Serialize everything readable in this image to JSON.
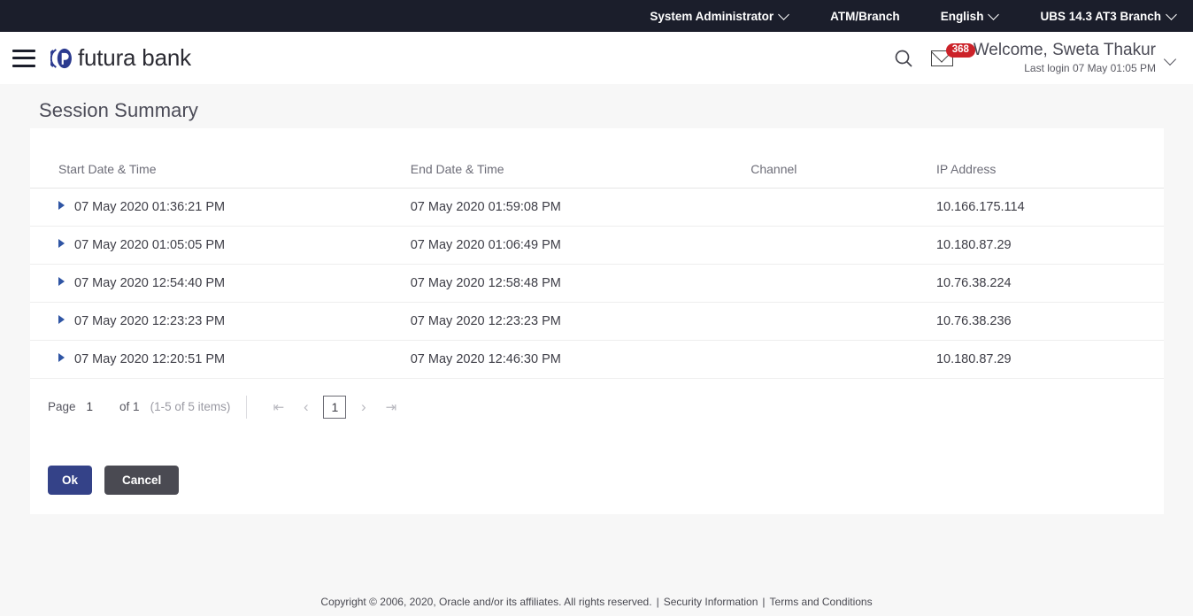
{
  "topbar": {
    "items": [
      {
        "label": "System Administrator",
        "has_chevron": true,
        "icon": "chevron-down-icon"
      },
      {
        "label": "ATM/Branch",
        "has_chevron": false,
        "icon": ""
      },
      {
        "label": "English",
        "has_chevron": true,
        "icon": "chevron-down-icon"
      },
      {
        "label": "UBS 14.3 AT3 Branch",
        "has_chevron": true,
        "icon": "chevron-down-icon"
      }
    ]
  },
  "header": {
    "menu_icon": "hamburger-menu-icon",
    "brand_name": "futura bank",
    "brand_logo_icon": "futura-bank-logo-icon",
    "search_icon": "search-icon",
    "mail_icon": "mail-envelope-icon",
    "mail_badge_count": "368",
    "welcome_text": "Welcome, Sweta Thakur",
    "last_login": "Last login 07 May 01:05 PM",
    "profile_chevron_icon": "chevron-down-icon"
  },
  "main": {
    "page_title": "Session Summary",
    "table": {
      "columns": [
        "Start Date & Time",
        "End Date & Time",
        "Channel",
        "IP Address"
      ],
      "rows": [
        {
          "expander_icon": "expand-triangle-icon",
          "start": "07 May 2020 01:36:21 PM",
          "end": "07 May 2020 01:59:08 PM",
          "channel": "",
          "ip": "10.166.175.114"
        },
        {
          "expander_icon": "expand-triangle-icon",
          "start": "07 May 2020 01:05:05 PM",
          "end": "07 May 2020 01:06:49 PM",
          "channel": "",
          "ip": "10.180.87.29"
        },
        {
          "expander_icon": "expand-triangle-icon",
          "start": "07 May 2020 12:54:40 PM",
          "end": "07 May 2020 12:58:48 PM",
          "channel": "",
          "ip": "10.76.38.224"
        },
        {
          "expander_icon": "expand-triangle-icon",
          "start": "07 May 2020 12:23:23 PM",
          "end": "07 May 2020 12:23:23 PM",
          "channel": "",
          "ip": "10.76.38.236"
        },
        {
          "expander_icon": "expand-triangle-icon",
          "start": "07 May 2020 12:20:51 PM",
          "end": "07 May 2020 12:46:30 PM",
          "channel": "",
          "ip": "10.180.87.29"
        }
      ]
    },
    "pagination": {
      "page_label": "Page",
      "page_value": "1",
      "of_label": "of 1",
      "items_label": "(1-5 of 5 items)",
      "first_icon": "first-page-icon",
      "prev_icon": "previous-page-icon",
      "current_page": "1",
      "next_icon": "next-page-icon",
      "last_icon": "last-page-icon"
    },
    "buttons": {
      "ok": "Ok",
      "cancel": "Cancel"
    }
  },
  "footer": {
    "copyright": "Copyright © 2006, 2020, Oracle and/or its affiliates. All rights reserved.",
    "security_link": "Security Information",
    "terms_link": "Terms and Conditions",
    "divider": "|"
  },
  "colors": {
    "topbar_bg": "#1b1e2b",
    "page_bg": "#f7f7f7",
    "card_bg": "#ffffff",
    "accent_blue": "#344288",
    "badge_red": "#cc2229",
    "expander_blue": "#2f55a4",
    "cancel_gray": "#4a4a52"
  }
}
